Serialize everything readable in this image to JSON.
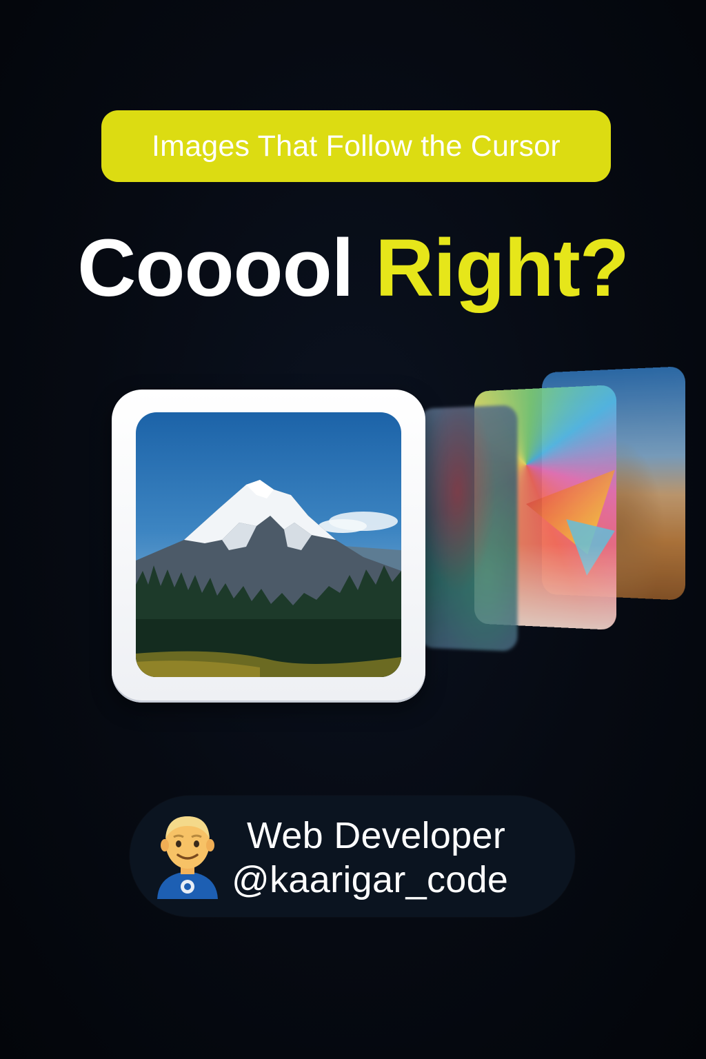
{
  "badge": {
    "label": "Images That Follow the Cursor"
  },
  "headline": {
    "word1": "Cooool",
    "word2": "Right?"
  },
  "colors": {
    "accent_yellow": "#e6e61a",
    "badge_bg": "#dcdc12",
    "background": "#060a12"
  },
  "gallery": {
    "main_image": "mountain-landscape",
    "trailing_images": [
      "blurred-abstract",
      "colorful-abstract-shapes",
      "desert-dunes"
    ]
  },
  "profile": {
    "avatar_icon": "man-technologist-emoji",
    "title": "Web Developer",
    "handle": "@kaarigar_code"
  }
}
